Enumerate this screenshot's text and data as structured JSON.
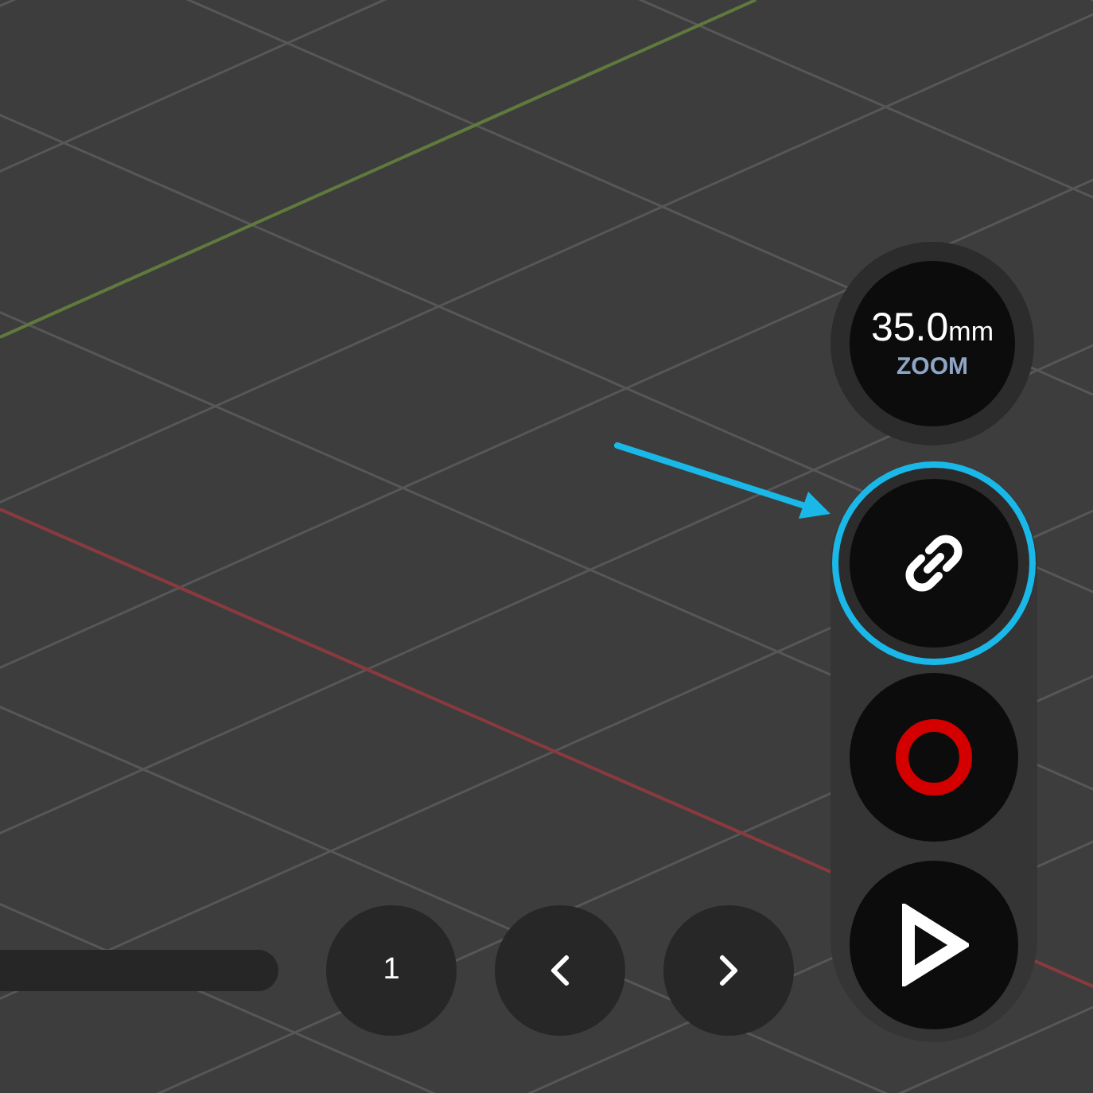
{
  "zoom_control": {
    "value": "35.0",
    "unit": "mm",
    "label": "ZOOM"
  },
  "tool_buttons": [
    {
      "kind": "link",
      "highlighted": true
    },
    {
      "kind": "record",
      "highlighted": false
    },
    {
      "kind": "play",
      "highlighted": false
    }
  ],
  "frame_bar": {
    "page": "1"
  }
}
